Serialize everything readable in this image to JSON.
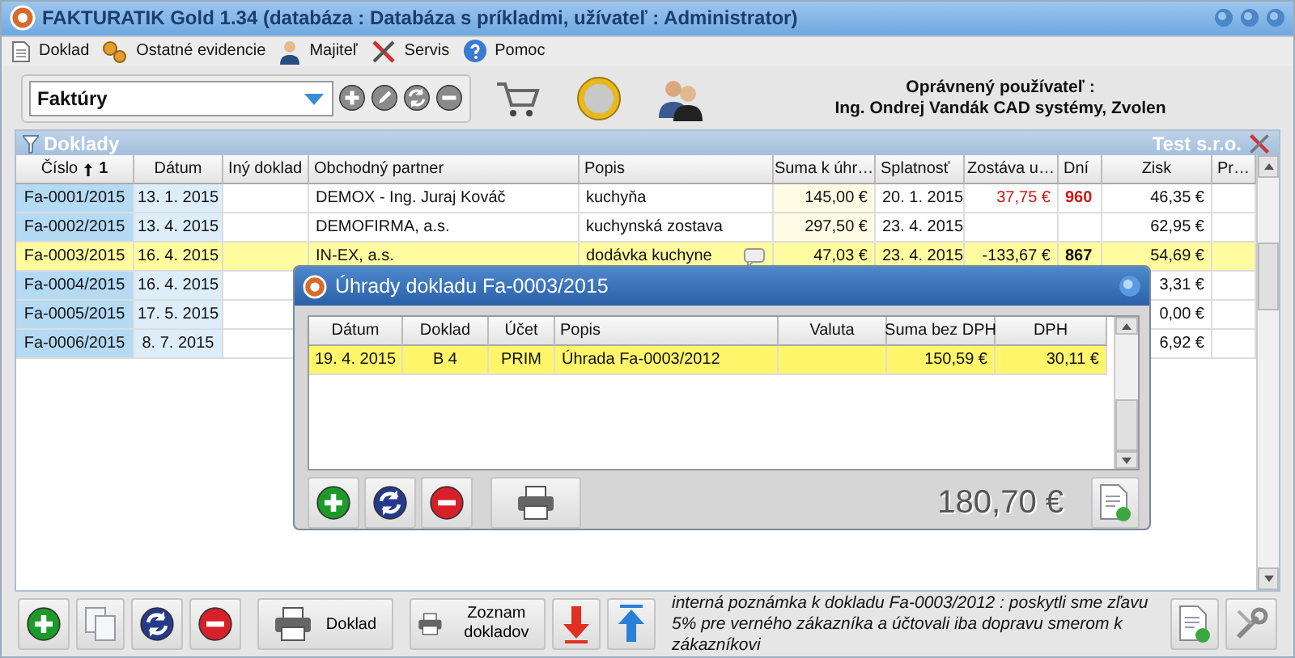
{
  "window": {
    "title": "FAKTURATIK Gold 1.34  (databáza : Databáza s príkladmi, užívateľ : Administrator)"
  },
  "menu": [
    {
      "label": "Doklad"
    },
    {
      "label": "Ostatné evidencie"
    },
    {
      "label": "Majiteľ"
    },
    {
      "label": "Servis"
    },
    {
      "label": "Pomoc"
    }
  ],
  "toolbar": {
    "combo_value": "Faktúry"
  },
  "licensed_user": {
    "label": "Oprávnený používateľ :",
    "name": "Ing. Ondrej Vandák CAD systémy, Zvolen"
  },
  "panel": {
    "title": "Doklady",
    "company": "Test s.r.o."
  },
  "table": {
    "columns": [
      {
        "label": "Číslo",
        "sort": "1"
      },
      {
        "label": "Dátum"
      },
      {
        "label": "Iný doklad"
      },
      {
        "label": "Obchodný partner"
      },
      {
        "label": "Popis"
      },
      {
        "label": "Suma k úhr…"
      },
      {
        "label": "Splatnosť"
      },
      {
        "label": "Zostáva u…"
      },
      {
        "label": "Dní"
      },
      {
        "label": "Zisk"
      },
      {
        "label": "Pr…"
      }
    ],
    "rows": [
      {
        "cislo": "Fa-0001/2015",
        "datum": "13. 1. 2015",
        "partner": "DEMOX - Ing. Juraj Kováč",
        "popis": "kuchyňa",
        "suma": "145,00 €",
        "splatnost": "20. 1. 2015",
        "zostava": "37,75 €",
        "dni": "960",
        "overdue": true,
        "zisk": "46,35 €",
        "has_note": false,
        "selected": false
      },
      {
        "cislo": "Fa-0002/2015",
        "datum": "13. 4. 2015",
        "partner": "DEMOFIRMA, a.s.",
        "popis": "kuchynská zostava",
        "suma": "297,50 €",
        "splatnost": "23. 4. 2015",
        "zisk": "62,95 €",
        "has_note": false,
        "selected": false
      },
      {
        "cislo": "Fa-0003/2015",
        "datum": "16. 4. 2015",
        "partner": "IN-EX, a.s.",
        "popis": "dodávka kuchyne",
        "suma": "47,03 €",
        "splatnost": "23. 4. 2015",
        "zostava": "-133,67 €",
        "dni": "867",
        "overdue": false,
        "zisk": "54,69 €",
        "has_note": true,
        "selected": true
      },
      {
        "cislo": "Fa-0004/2015",
        "datum": "16. 4. 2015",
        "zisk": "3,31 €",
        "selected": false
      },
      {
        "cislo": "Fa-0005/2015",
        "datum": "17. 5. 2015",
        "zisk": "0,00 €",
        "selected": false
      },
      {
        "cislo": "Fa-0006/2015",
        "datum": "8. 7. 2015",
        "zisk": "6,92 €",
        "selected": false
      }
    ]
  },
  "dialog": {
    "title": "Úhrady dokladu Fa-0003/2015",
    "columns": [
      "Dátum",
      "Doklad",
      "Účet",
      "Popis",
      "Valuta",
      "Suma bez DPH",
      "DPH"
    ],
    "rows": [
      {
        "datum": "19. 4. 2015",
        "doklad": "B 4",
        "ucet": "PRIM",
        "popis": "Úhrada Fa-0003/2012",
        "suma": "150,59 €",
        "dph": "30,11 €",
        "selected": true
      }
    ],
    "total": "180,70 €"
  },
  "bottom": {
    "print_document": "Doklad",
    "print_list": "Zoznam dokladov",
    "note": "interná poznámka k dokladu Fa-0003/2012 : poskytli sme zľavu 5% pre verného zákazníka a účtovali iba dopravu smerom k zákazníkovi"
  }
}
